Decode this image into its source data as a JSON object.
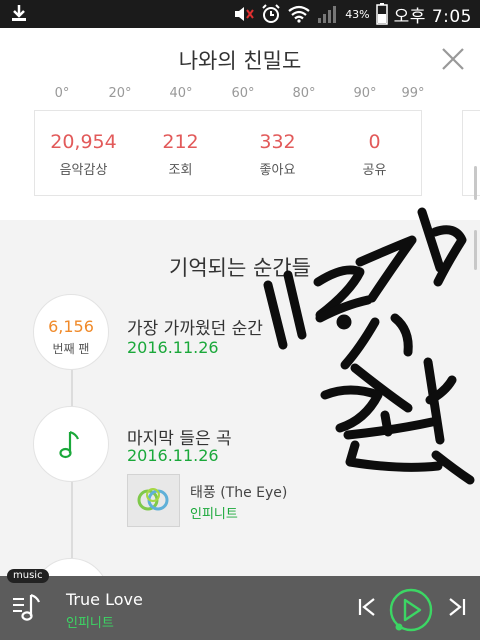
{
  "status_bar": {
    "battery_percent": "43%",
    "time": "오후 7:05",
    "icons": [
      "download-icon",
      "mute-icon",
      "alarm-icon",
      "wifi-icon",
      "signal-icon",
      "battery-icon"
    ]
  },
  "header": {
    "title": "나와의 친밀도",
    "close_icon": "close-icon"
  },
  "scale": {
    "ticks": [
      "0°",
      "20°",
      "40°",
      "60°",
      "80°",
      "90°",
      "99°"
    ]
  },
  "stats": [
    {
      "value": "20,954",
      "label": "음악감상"
    },
    {
      "value": "212",
      "label": "조회"
    },
    {
      "value": "332",
      "label": "좋아요"
    },
    {
      "value": "0",
      "label": "공유"
    }
  ],
  "moments": {
    "title": "기억되는 순간들",
    "first_fan": {
      "number": "6,156",
      "unit": "번째 팬",
      "title": "가장 가까웠던 순간",
      "date": "2016.11.26"
    },
    "last_listened": {
      "title": "마지막 들은 곡",
      "date": "2016.11.26",
      "song": {
        "title": "태풍 (The Eye)",
        "artist": "인피니트"
      }
    }
  },
  "player": {
    "tag": "music",
    "title": "True Love",
    "artist": "인피니트",
    "colors": {
      "accent": "#3cd664",
      "bar": "#5c5c5c"
    }
  },
  "colors": {
    "stat_value": "#e25a5a",
    "fan_number": "#f08a2a",
    "date": "#1aa83a"
  }
}
